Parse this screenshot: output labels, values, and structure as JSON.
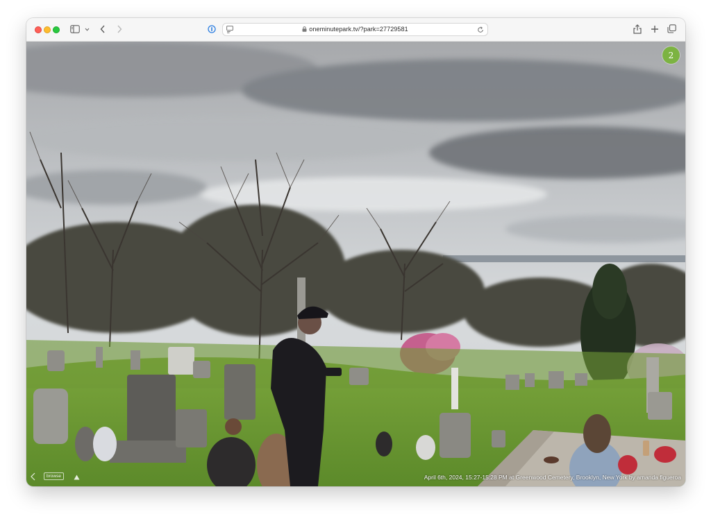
{
  "browser": {
    "url": "oneminutepark.tv/?park=27729581",
    "icons": [
      "sidebar-icon",
      "chevron-down-icon",
      "back-icon",
      "forward-icon",
      "privacy-report-icon",
      "page-menu-icon",
      "lock-icon",
      "reload-icon",
      "share-icon",
      "new-tab-icon",
      "tab-overview-icon"
    ]
  },
  "page": {
    "badge_number": "2",
    "browse_label": "browse",
    "caption": "April 6th, 2024, 15:27-15:28 PM at Greenwood Cemetery, Brooklyn, New York by amanda figueroa"
  },
  "colors": {
    "badge": "#7cb342",
    "traffic_red": "#fe5f57",
    "traffic_yellow": "#febc2e",
    "traffic_green": "#28c840",
    "privacy_icon": "#2a7de1"
  }
}
